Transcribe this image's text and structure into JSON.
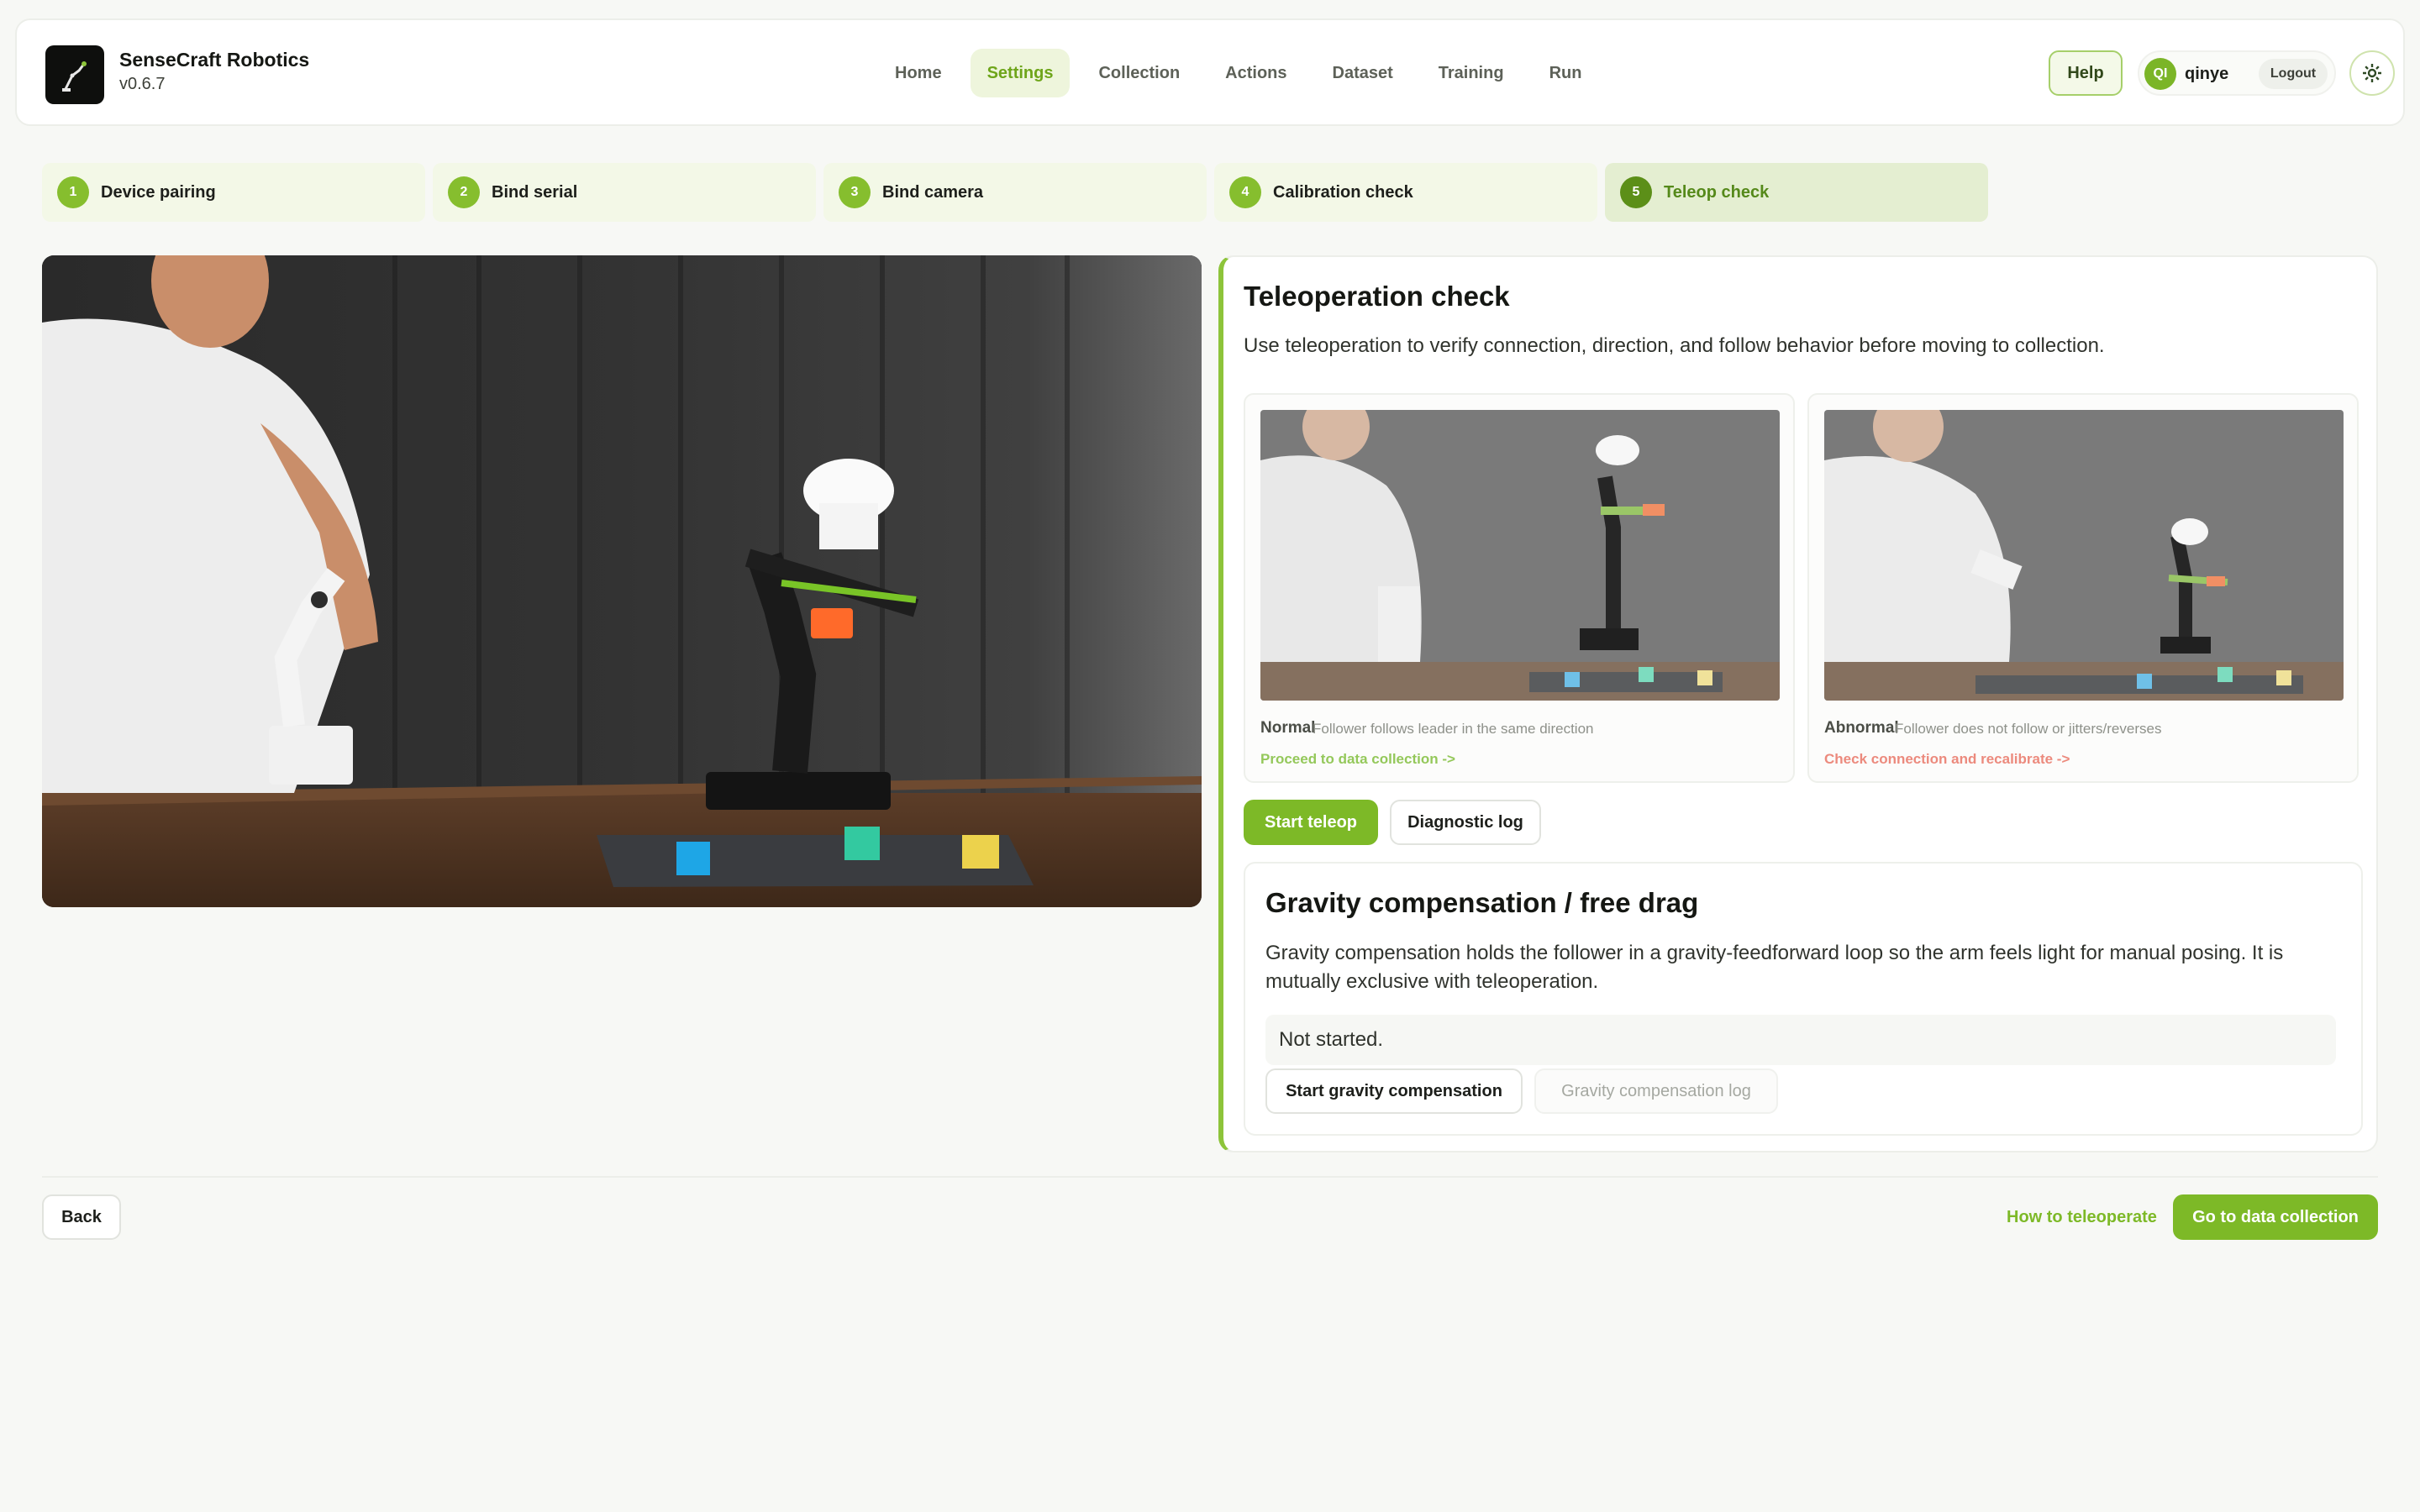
{
  "brand": {
    "name": "SenseCraft Robotics",
    "version": "v0.6.7"
  },
  "nav": [
    {
      "label": "Home",
      "active": false
    },
    {
      "label": "Settings",
      "active": true
    },
    {
      "label": "Collection",
      "active": false
    },
    {
      "label": "Actions",
      "active": false
    },
    {
      "label": "Dataset",
      "active": false
    },
    {
      "label": "Training",
      "active": false
    },
    {
      "label": "Run",
      "active": false
    }
  ],
  "header": {
    "help_label": "Help",
    "user_initials": "QI",
    "username": "qinye",
    "logout_label": "Logout",
    "settings_icon": "gear-icon"
  },
  "steps": [
    {
      "num": "1",
      "label": "Device pairing"
    },
    {
      "num": "2",
      "label": "Bind serial"
    },
    {
      "num": "3",
      "label": "Bind camera"
    },
    {
      "num": "4",
      "label": "Calibration check"
    },
    {
      "num": "5",
      "label": "Teleop check",
      "active": true
    }
  ],
  "panel": {
    "title": "Teleoperation check",
    "description": "Use teleoperation to verify connection, direction, and follow behavior before moving to collection.",
    "examples": {
      "normal": {
        "head": "Normal",
        "desc": "Follower follows leader in the same direction",
        "link": "Proceed to data collection ->"
      },
      "abnormal": {
        "head": "Abnormal",
        "desc": "Follower does not follow or jitters/reverses",
        "link": "Check connection and recalibrate ->"
      }
    },
    "start_teleop_label": "Start teleop",
    "diagnostic_log_label": "Diagnostic log"
  },
  "gravity": {
    "title": "Gravity compensation / free drag",
    "description": "Gravity compensation holds the follower in a gravity-feedforward loop so the arm feels light for manual posing. It is mutually exclusive with teleoperation.",
    "status": "Not started.",
    "start_label": "Start gravity compensation",
    "log_label": "Gravity compensation log"
  },
  "footer": {
    "back_label": "Back",
    "howto_label": "How to teleoperate",
    "go_label": "Go to data collection"
  },
  "colors": {
    "accent": "#7db927",
    "accent_light": "#f3f8e7",
    "error": "#ec8a7d"
  }
}
